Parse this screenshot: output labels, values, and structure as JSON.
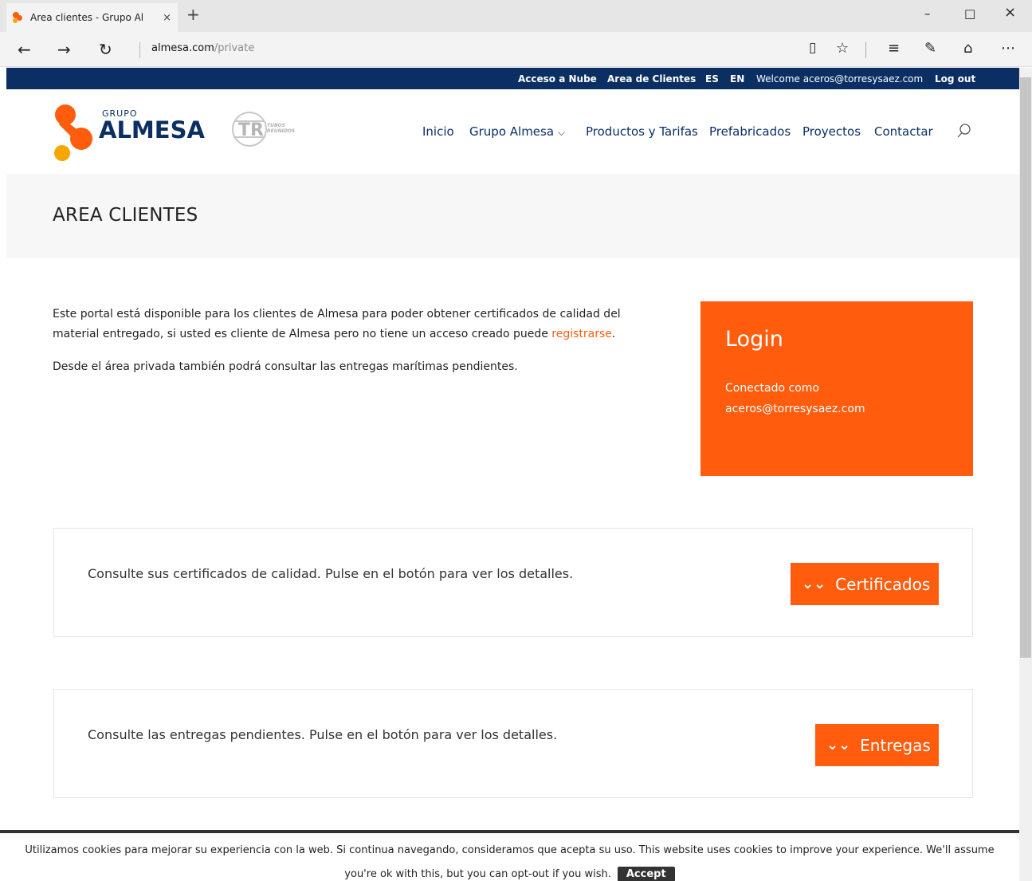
{
  "browser": {
    "tab_title": "Area clientes - Grupo Al",
    "tab_close": "×",
    "new_tab": "+",
    "win_minimize": "–",
    "win_maximize": "□",
    "win_close": "×",
    "url_host": "almesa.com",
    "url_path": "/private",
    "icons": [
      "back-icon",
      "forward-icon",
      "refresh-icon",
      "reading-view-icon",
      "favorite-star-icon",
      "hub-icon",
      "web-note-icon",
      "share-icon",
      "more-icon"
    ]
  },
  "topbar": {
    "acceso_nube": "Acceso a Nube",
    "area_clientes": "Area de Clientes",
    "lang_es": "ES",
    "lang_en": "EN",
    "welcome": "Welcome aceros@torresysaez.com",
    "logout": "Log out"
  },
  "header": {
    "logo_small": "GRUPO",
    "logo_big": "ALMESA",
    "tr_text": "TUBOS REUNIDOS",
    "nav": {
      "inicio": "Inicio",
      "grupo": "Grupo Almesa",
      "productos": "Productos y Tarifas",
      "prefabricados": "Prefabricados",
      "proyectos": "Proyectos",
      "contactar": "Contactar"
    }
  },
  "page": {
    "title": "AREA CLIENTES",
    "intro_p1_a": "Este portal está disponible para los clientes de Almesa para poder obtener certificados de calidad del material entregado, si usted es cliente de Almesa pero no tiene un acceso creado puede ",
    "intro_link": "registrarse",
    "intro_p1_b": ".",
    "intro_p2": "Desde el área privada también podrá consultar las entregas marítimas pendientes."
  },
  "login": {
    "title": "Login",
    "connected_as": "Conectado como",
    "email": "aceros@torresysaez.com"
  },
  "panels": {
    "certificados_text": "Consulte sus certificados de calidad. Pulse en el botón para ver los detalles.",
    "certificados_btn": "Certificados",
    "entregas_text": "Consulte las entregas pendientes. Pulse en el botón para ver los detalles.",
    "entregas_btn": "Entregas",
    "chevron": "≫"
  },
  "cookie": {
    "line1": "Utilizamos cookies para mejorar su experiencia con la web. Si continua navegando, consideramos que acepta su uso. This website uses cookies to improve your experience. We'll assume",
    "line2": "you're ok with this, but you can opt-out if you wish.",
    "accept": "Accept"
  },
  "colors": {
    "brand_blue": "#0b2f63",
    "brand_orange": "#ff5c0e",
    "logo_yellow": "#f7a600"
  }
}
